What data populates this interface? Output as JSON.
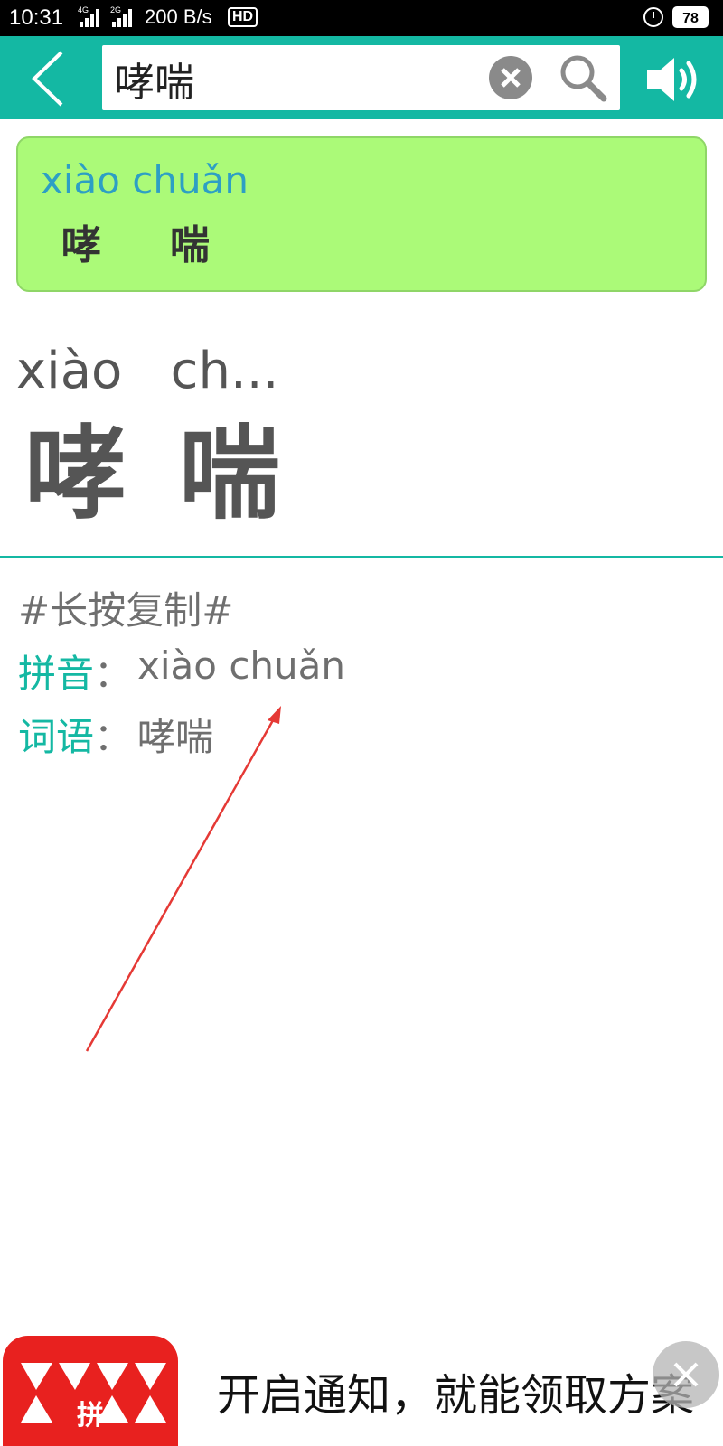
{
  "status_bar": {
    "time": "10:31",
    "net_1": "4G",
    "net_2": "2G",
    "speed": "200 B/s",
    "hd": "HD",
    "battery": "78"
  },
  "search": {
    "query": "哮喘",
    "icons": {
      "back": "chevron-left-icon",
      "clear": "close-circle-icon",
      "search": "search-icon",
      "speaker": "speaker-icon"
    }
  },
  "result_card": {
    "pinyin": "xiào chuǎn",
    "chars": [
      "哮",
      "喘"
    ]
  },
  "display": {
    "pinyin": "xiào   ch...",
    "chars": [
      "哮",
      "喘"
    ]
  },
  "detail": {
    "copy_hint": "#长按复制#",
    "pinyin_label": "拼音",
    "pinyin_value": "xiào chuǎn",
    "word_label": "词语",
    "word_value": "哮喘",
    "colon": "："
  },
  "ad": {
    "text": "开启通知，就能领取方案",
    "logo_char": "拼"
  },
  "colors": {
    "accent": "#14b8a3",
    "card_bg": "#abfa78",
    "pinyin_blue": "#2d9fc4",
    "arrow": "#e53935",
    "ad_red": "#e8211f"
  }
}
